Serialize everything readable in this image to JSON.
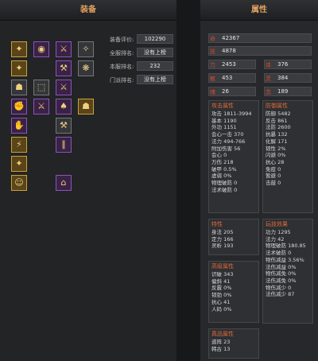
{
  "equip": {
    "title": "装备",
    "rank": [
      {
        "label": "装备评价:",
        "value": "102290"
      },
      {
        "label": "全服排名:",
        "value": "没有上榜"
      },
      {
        "label": "本服排名:",
        "value": "232"
      },
      {
        "label": "门派排名:",
        "value": "没有上榜"
      }
    ],
    "slots_icon": "equipment-item-icon"
  },
  "attr": {
    "title": "属性",
    "bars": [
      {
        "key": "命",
        "value": "42367"
      },
      {
        "key": "技",
        "value": "4878"
      }
    ],
    "pairs": [
      {
        "k1": "力",
        "v1": "2453",
        "k2": "体",
        "v2": "376"
      },
      {
        "k1": "敏",
        "v1": "453",
        "k2": "灵",
        "v2": "384"
      },
      {
        "k1": "魂",
        "v1": "26",
        "k2": "念",
        "v2": "189"
      }
    ],
    "attack": {
      "title": "攻击属性",
      "lines": [
        "攻击 1811-3994",
        "基本 1190",
        "外功 1151",
        "会心一击 370",
        "法力 494-766",
        "附加伤害 56",
        "会心 0",
        "万伤 218",
        "破甲 0.5%",
        "虚弱 0%",
        "物理破防 0",
        "法术破防 0"
      ]
    },
    "defense": {
      "title": "防御属性",
      "lines": [
        "防御 5482",
        "反击 861",
        "法防 2600",
        "抗暴 132",
        "化解 171",
        "韧性 2%",
        "闪避 0%",
        "抗心 28",
        "免疫 0",
        "暂避 0",
        "击鼓 0"
      ]
    },
    "special": {
      "title": "特性",
      "lines": [
        "身法 205",
        "定力 166",
        "灵析 193"
      ]
    },
    "skill": {
      "title": "玩技效果",
      "lines": [
        "功力 1295",
        "法力 42",
        "物理破防 180.85",
        "法术破防 0",
        "物伤减益 3.56%",
        "法伤减益 0%",
        "物伤减免 0%",
        "法伤减免 0%",
        "物伤减少 0",
        "法伤减少 87"
      ]
    },
    "advanced": {
      "title": "高级属性",
      "lines": [
        "识破 343",
        "偏斜 41",
        "反震 0%",
        "韧劲 0%",
        "抗心 41",
        "人码 0%"
      ]
    },
    "truth": {
      "title": "真品属性",
      "lines": [
        "道阵 23",
        "韩古 13"
      ]
    }
  }
}
